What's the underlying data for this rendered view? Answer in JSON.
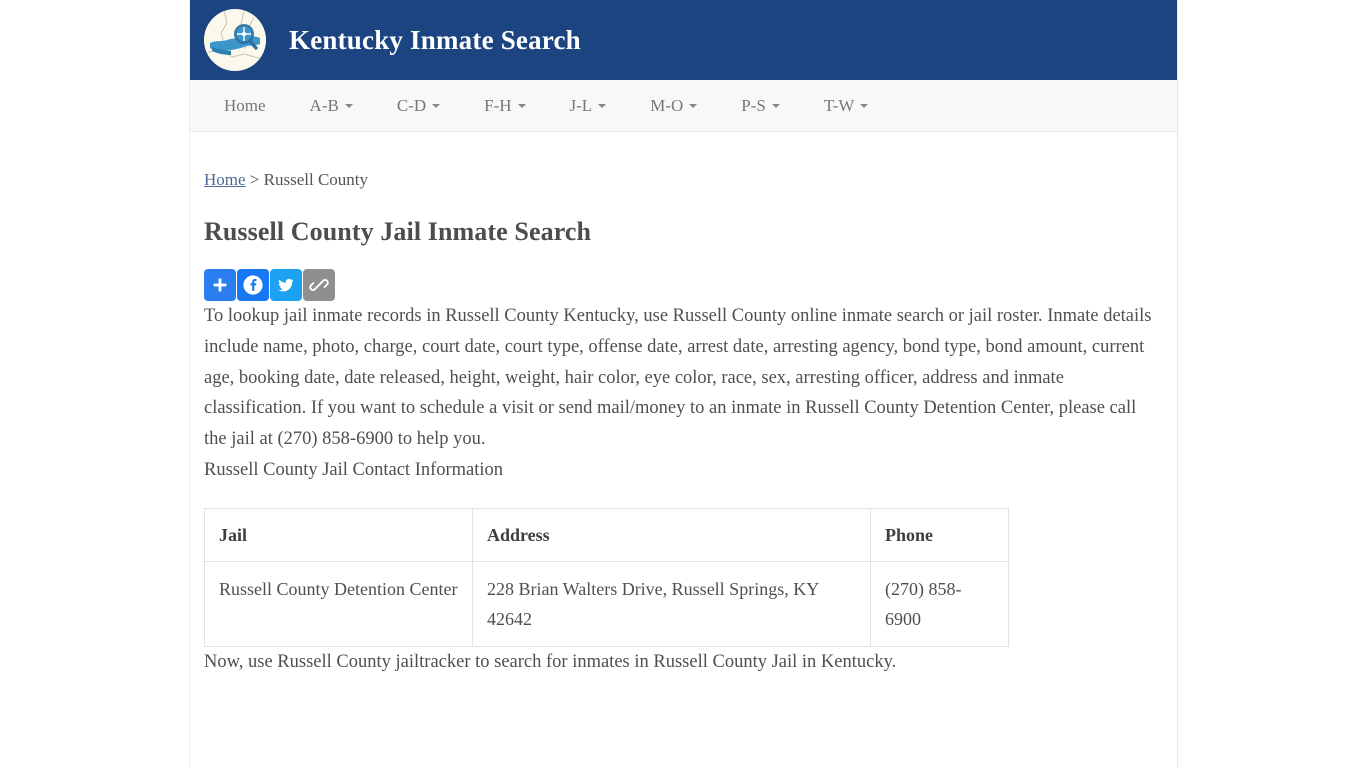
{
  "header": {
    "site_title": "Kentucky Inmate Search",
    "logo_icon": "kentucky-map-magnifier-icon",
    "background_color": "#1b4480"
  },
  "nav": {
    "items": [
      {
        "label": "Home",
        "has_dropdown": false
      },
      {
        "label": "A-B",
        "has_dropdown": true
      },
      {
        "label": "C-D",
        "has_dropdown": true
      },
      {
        "label": "F-H",
        "has_dropdown": true
      },
      {
        "label": "J-L",
        "has_dropdown": true
      },
      {
        "label": "M-O",
        "has_dropdown": true
      },
      {
        "label": "P-S",
        "has_dropdown": true
      },
      {
        "label": "T-W",
        "has_dropdown": true
      }
    ]
  },
  "breadcrumb": {
    "home_label": "Home",
    "separator": ">",
    "current": "Russell County"
  },
  "main": {
    "page_title": "Russell County Jail Inmate Search",
    "intro_paragraph": "To lookup jail inmate records in Russell County Kentucky, use Russell County online inmate search or jail roster. Inmate details include name, photo, charge, court date, court type, offense date, arrest date, arresting agency, bond type, bond amount, current age, booking date, date released, height, weight, hair color, eye color, race, sex, arresting officer, address and inmate classification. If you want to schedule a visit or send mail/money to an inmate in Russell County Detention Center, please call the jail at (270) 858-6900 to help you.",
    "contact_heading": "Russell County Jail Contact Information",
    "outro_paragraph": "Now, use Russell County jailtracker to search for inmates in Russell County Jail in Kentucky."
  },
  "share": {
    "buttons": [
      {
        "name": "addthis-share",
        "icon": "plus-icon",
        "label": "Share",
        "color": "#2b7ef0"
      },
      {
        "name": "facebook-share",
        "icon": "facebook-icon",
        "label": "Facebook",
        "color": "#1877f2"
      },
      {
        "name": "twitter-share",
        "icon": "twitter-icon",
        "label": "Twitter",
        "color": "#1da1f2"
      },
      {
        "name": "copy-link-share",
        "icon": "chain-link-icon",
        "label": "Copy Link",
        "color": "#8f8f8f"
      }
    ]
  },
  "contact_table": {
    "headers": [
      "Jail",
      "Address",
      "Phone"
    ],
    "rows": [
      {
        "jail": "Russell County Detention Center",
        "address": "228 Brian Walters Drive, Russell Springs, KY 42642",
        "phone": "(270) 858-6900"
      }
    ]
  }
}
